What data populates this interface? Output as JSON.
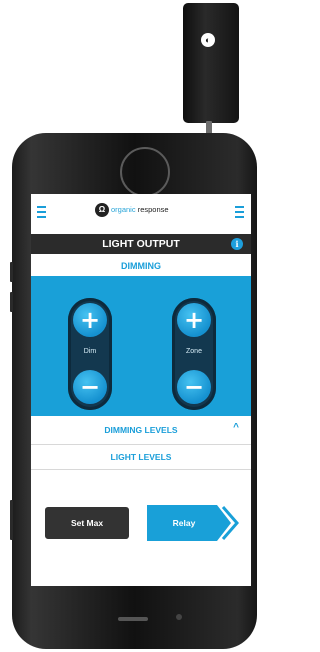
{
  "header": {
    "logo_text_main": "organic",
    "logo_text_sub": "response"
  },
  "title": "LIGHT OUTPUT",
  "info_icon": "i",
  "dimming": {
    "header": "DIMMING",
    "controls": [
      {
        "label": "Dim",
        "plus": "+",
        "minus": "−"
      },
      {
        "label": "Zone",
        "plus": "+",
        "minus": "−"
      }
    ]
  },
  "dimming_levels": {
    "label": "DIMMING LEVELS",
    "chevron": "^"
  },
  "light_levels": {
    "label": "LIGHT LEVELS"
  },
  "buttons": {
    "set_max": "Set Max",
    "relay": "Relay"
  },
  "colors": {
    "accent": "#19a0d8",
    "dark": "#2b2b2b"
  }
}
